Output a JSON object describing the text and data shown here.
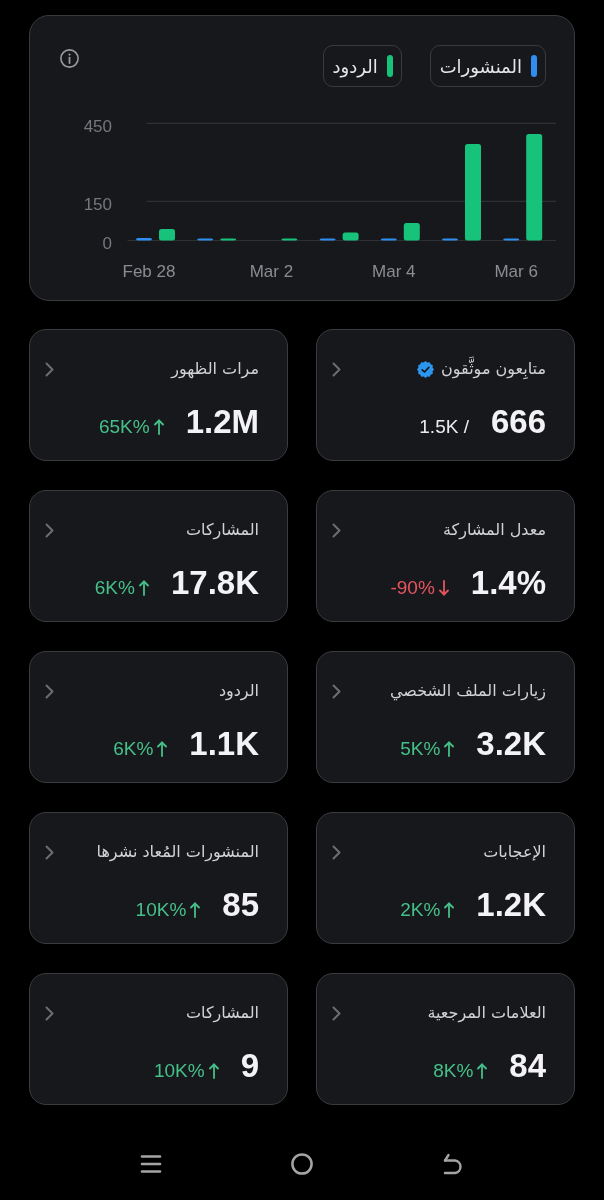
{
  "chart": {
    "chart_data": {
      "type": "bar",
      "legend": "top-right",
      "categories": [
        "Feb 28",
        null,
        "Mar 2",
        null,
        "Mar 4",
        null,
        "Mar 6"
      ],
      "series": [
        {
          "name": "المنشورات",
          "color": "#2f8ff0",
          "values": [
            10,
            4,
            0,
            5,
            5,
            6,
            6
          ]
        },
        {
          "name": "الردود",
          "color": "#17c37b",
          "values": [
            44,
            3,
            6,
            31,
            67,
            371,
            409
          ]
        }
      ],
      "ylim": [
        0,
        450
      ],
      "yticks": [
        0,
        150,
        450
      ]
    }
  },
  "stats": [
    {
      "kind": "ratio",
      "title": "متابِعون موثَّقون",
      "verified": true,
      "value": "666",
      "total": "1.5K /"
    },
    {
      "kind": "change",
      "title": "مرات الظهور",
      "verified": false,
      "value": "1.2M",
      "change": "65K%",
      "negative": false
    },
    {
      "kind": "change",
      "title": "معدل المشاركة",
      "verified": false,
      "value": "1.4%",
      "change": "-90%",
      "negative": true
    },
    {
      "kind": "change",
      "title": "المشاركات",
      "verified": false,
      "value": "17.8K",
      "change": "6K%",
      "negative": false
    },
    {
      "kind": "change",
      "title": "زيارات الملف الشخصي",
      "verified": false,
      "value": "3.2K",
      "change": "5K%",
      "negative": false
    },
    {
      "kind": "change",
      "title": "الردود",
      "verified": false,
      "value": "1.1K",
      "change": "6K%",
      "negative": false
    },
    {
      "kind": "change",
      "title": "الإعجابات",
      "verified": false,
      "value": "1.2K",
      "change": "2K%",
      "negative": false
    },
    {
      "kind": "change",
      "title": "المنشورات المُعاد نشرها",
      "verified": false,
      "value": "85",
      "change": "10K%",
      "negative": false
    },
    {
      "kind": "change",
      "title": "العلامات المرجعية",
      "verified": false,
      "value": "84",
      "change": "8K%",
      "negative": false
    },
    {
      "kind": "change",
      "title": "المشاركات",
      "verified": false,
      "value": "9",
      "change": "10K%",
      "negative": false
    }
  ]
}
